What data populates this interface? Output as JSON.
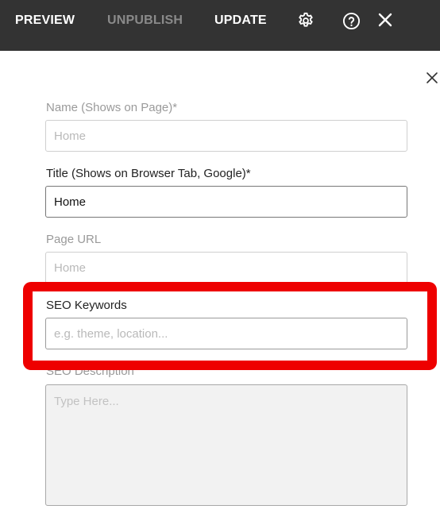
{
  "toolbar": {
    "preview_label": "PREVIEW",
    "unpublish_label": "UNPUBLISH",
    "update_label": "UPDATE",
    "settings_icon": "gear-icon",
    "help_icon": "question-circle-icon",
    "close_icon": "close-icon"
  },
  "panel": {
    "close_icon": "close-icon",
    "fields": {
      "name": {
        "label": "Name (Shows on Page)*",
        "placeholder": "Home",
        "value": ""
      },
      "title": {
        "label": "Title (Shows on Browser Tab, Google)*",
        "value": "Home"
      },
      "page_url": {
        "label": "Page URL",
        "placeholder": "Home",
        "value": ""
      },
      "seo_keywords": {
        "label": "SEO Keywords",
        "placeholder": "e.g. theme, location...",
        "value": ""
      },
      "seo_description": {
        "label": "SEO Description",
        "placeholder": "Type Here...",
        "value": ""
      }
    }
  },
  "colors": {
    "toolbar_bg": "#333333",
    "highlight": "#ee0000"
  }
}
